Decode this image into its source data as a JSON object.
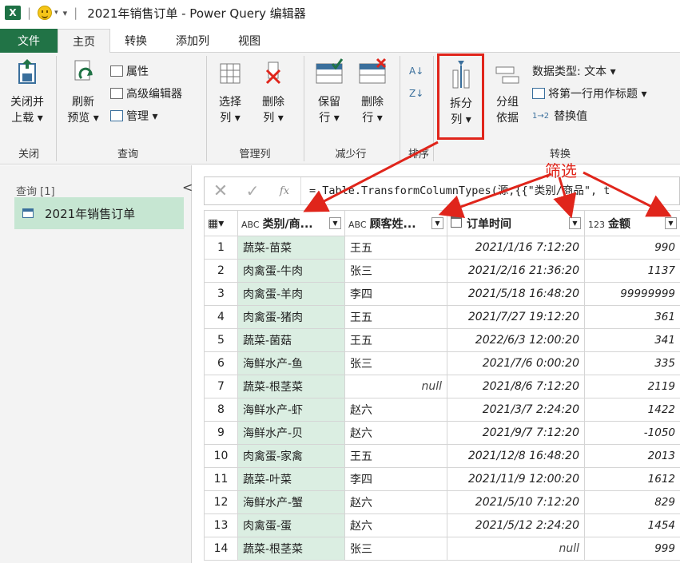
{
  "window": {
    "app_logo": "X",
    "title": "2021年销售订单 - Power Query 编辑器"
  },
  "tabs": [
    {
      "label": "文件"
    },
    {
      "label": "主页"
    },
    {
      "label": "转换"
    },
    {
      "label": "添加列"
    },
    {
      "label": "视图"
    }
  ],
  "ribbon": {
    "close_load": {
      "line1": "关闭并",
      "line2": "上载 ▾"
    },
    "refresh": {
      "line1": "刷新",
      "line2": "预览 ▾"
    },
    "properties": "属性",
    "advanced_editor": "高级编辑器",
    "manage": "管理 ▾",
    "choose_columns": {
      "line1": "选择",
      "line2": "列 ▾"
    },
    "remove_columns": {
      "line1": "删除",
      "line2": "列 ▾"
    },
    "keep_rows": {
      "line1": "保留",
      "line2": "行 ▾"
    },
    "remove_rows": {
      "line1": "删除",
      "line2": "行 ▾"
    },
    "split_column": {
      "line1": "拆分",
      "line2": "列 ▾"
    },
    "group_by": {
      "line1": "分组",
      "line2": "依据"
    },
    "data_type": "数据类型: 文本 ▾",
    "first_row_header": "将第一行用作标题 ▾",
    "replace_values": "替换值",
    "groups": {
      "close": "关闭",
      "query": "查询",
      "manage_columns": "管理列",
      "reduce_rows": "减少行",
      "sort": "排序",
      "transform": "转换"
    }
  },
  "query_pane": {
    "header": "查询 [1]",
    "collapse": "<",
    "item": "2021年销售订单"
  },
  "formula_bar": {
    "cancel": "✕",
    "confirm": "✓",
    "fx": "fx",
    "text": "= Table.TransformColumnTypes(源,{{\"类别/商品\", t"
  },
  "annotation": {
    "label": "筛选",
    "color": "#e0251b"
  },
  "grid": {
    "columns": [
      {
        "type": "ABC",
        "label": "类别/商..."
      },
      {
        "type": "ABC",
        "label": "顾客姓..."
      },
      {
        "type": "cal",
        "label": "订单时间"
      },
      {
        "type": "123",
        "label": "金额"
      }
    ],
    "rows": [
      {
        "n": "1",
        "cat": "蔬菜-苗菜",
        "name": "王五",
        "time": "2021/1/16 7:12:20",
        "amount": "990"
      },
      {
        "n": "2",
        "cat": "肉禽蛋-牛肉",
        "name": "张三",
        "time": "2021/2/16 21:36:20",
        "amount": "1137"
      },
      {
        "n": "3",
        "cat": "肉禽蛋-羊肉",
        "name": "李四",
        "time": "2021/5/18 16:48:20",
        "amount": "99999999"
      },
      {
        "n": "4",
        "cat": "肉禽蛋-猪肉",
        "name": "王五",
        "time": "2021/7/27 19:12:20",
        "amount": "361"
      },
      {
        "n": "5",
        "cat": "蔬菜-菌菇",
        "name": "王五",
        "time": "2022/6/3 12:00:20",
        "amount": "341"
      },
      {
        "n": "6",
        "cat": "海鲜水产-鱼",
        "name": "张三",
        "time": "2021/7/6 0:00:20",
        "amount": "335"
      },
      {
        "n": "7",
        "cat": "蔬菜-根茎菜",
        "name": "null",
        "time": "2021/8/6 7:12:20",
        "amount": "2119"
      },
      {
        "n": "8",
        "cat": "海鲜水产-虾",
        "name": "赵六",
        "time": "2021/3/7 2:24:20",
        "amount": "1422"
      },
      {
        "n": "9",
        "cat": "海鲜水产-贝",
        "name": "赵六",
        "time": "2021/9/7 7:12:20",
        "amount": "-1050"
      },
      {
        "n": "10",
        "cat": "肉禽蛋-家禽",
        "name": "王五",
        "time": "2021/12/8 16:48:20",
        "amount": "2013"
      },
      {
        "n": "11",
        "cat": "蔬菜-叶菜",
        "name": "李四",
        "time": "2021/11/9 12:00:20",
        "amount": "1612"
      },
      {
        "n": "12",
        "cat": "海鲜水产-蟹",
        "name": "赵六",
        "time": "2021/5/10 7:12:20",
        "amount": "829"
      },
      {
        "n": "13",
        "cat": "肉禽蛋-蛋",
        "name": "赵六",
        "time": "2021/5/12 2:24:20",
        "amount": "1454"
      },
      {
        "n": "14",
        "cat": "蔬菜-根茎菜",
        "name": "张三",
        "time": "null",
        "amount": "999"
      }
    ]
  }
}
